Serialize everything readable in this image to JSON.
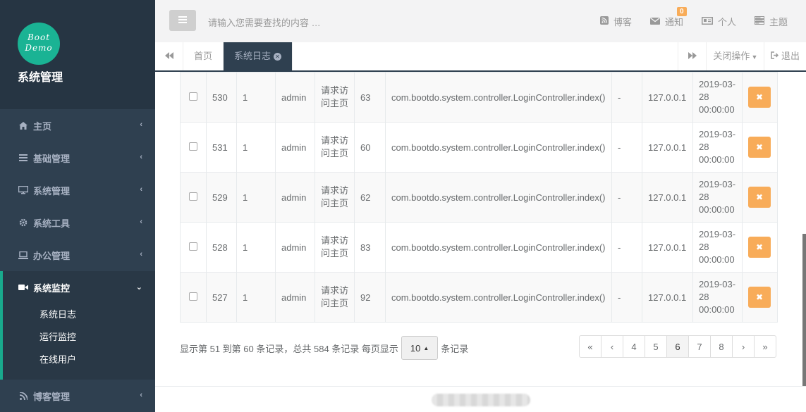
{
  "sidebar": {
    "logo_text_line1": "Boot",
    "logo_text_line2": "Demo",
    "brand": "系统管理",
    "menu": [
      {
        "label": "主页",
        "icon": "home-icon"
      },
      {
        "label": "基础管理",
        "icon": "list-icon"
      },
      {
        "label": "系统管理",
        "icon": "desktop-icon"
      },
      {
        "label": "系统工具",
        "icon": "gear-icon"
      },
      {
        "label": "办公管理",
        "icon": "laptop-icon"
      }
    ],
    "active_menu": {
      "label": "系统监控",
      "icon": "video-camera-icon"
    },
    "submenu": [
      "系统日志",
      "运行监控",
      "在线用户"
    ],
    "bottom_menu": {
      "label": "博客管理",
      "icon": "rss-icon"
    }
  },
  "topbar": {
    "search_placeholder": "请输入您需要查找的内容 …",
    "links": [
      {
        "label": "博客",
        "icon": "rss-square-icon"
      },
      {
        "label": "通知",
        "icon": "envelope-icon",
        "badge": "0"
      },
      {
        "label": "个人",
        "icon": "id-card-icon"
      },
      {
        "label": "主题",
        "icon": "tasks-icon"
      }
    ]
  },
  "tabs": {
    "items": [
      "首页",
      "系统日志"
    ],
    "active": "系统日志",
    "close_ops": "关闭操作",
    "logout": "退出"
  },
  "table": {
    "rows": [
      {
        "id": "530",
        "user_id": "1",
        "username": "admin",
        "operation": "请求访问主页",
        "time": "63",
        "method": "com.bootdo.system.controller.LoginController.index()",
        "params": "-",
        "ip": "127.0.0.1",
        "date_1": "2019-03-",
        "date_2": "28",
        "date_3": "00:00:00"
      },
      {
        "id": "531",
        "user_id": "1",
        "username": "admin",
        "operation": "请求访问主页",
        "time": "60",
        "method": "com.bootdo.system.controller.LoginController.index()",
        "params": "-",
        "ip": "127.0.0.1",
        "date_1": "2019-03-",
        "date_2": "28",
        "date_3": "00:00:00"
      },
      {
        "id": "529",
        "user_id": "1",
        "username": "admin",
        "operation": "请求访问主页",
        "time": "62",
        "method": "com.bootdo.system.controller.LoginController.index()",
        "params": "-",
        "ip": "127.0.0.1",
        "date_1": "2019-03-",
        "date_2": "28",
        "date_3": "00:00:00"
      },
      {
        "id": "528",
        "user_id": "1",
        "username": "admin",
        "operation": "请求访问主页",
        "time": "83",
        "method": "com.bootdo.system.controller.LoginController.index()",
        "params": "-",
        "ip": "127.0.0.1",
        "date_1": "2019-03-",
        "date_2": "28",
        "date_3": "00:00:00"
      },
      {
        "id": "527",
        "user_id": "1",
        "username": "admin",
        "operation": "请求访问主页",
        "time": "92",
        "method": "com.bootdo.system.controller.LoginController.index()",
        "params": "-",
        "ip": "127.0.0.1",
        "date_1": "2019-03-",
        "date_2": "28",
        "date_3": "00:00:00"
      }
    ]
  },
  "pager": {
    "info_prefix": "显示第 51 到第 60 条记录，总共 584 条记录 每页显示",
    "page_size": "10",
    "info_suffix": "条记录",
    "pages": [
      "«",
      "‹",
      "4",
      "5",
      "6",
      "7",
      "8",
      "›",
      "»"
    ],
    "active_page": "6"
  },
  "colors": {
    "sidebar_bg": "#2f4050",
    "accent": "#1ab394",
    "warning": "#f8ac59"
  }
}
